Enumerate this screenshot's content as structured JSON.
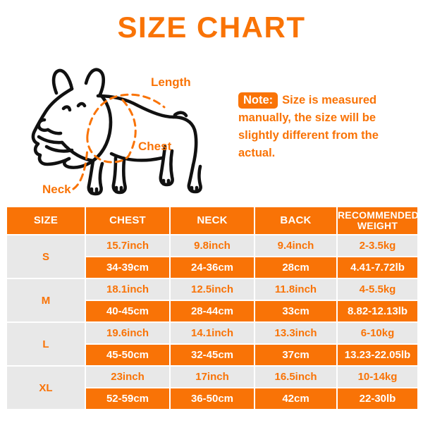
{
  "title": "SIZE CHART",
  "theme": {
    "accent": "#F97306",
    "light_row": "#E8E8E8",
    "size_cell": "#E4E4E4",
    "text_on_accent": "#FFFFFF",
    "outline": "#000000"
  },
  "note": {
    "badge": "Note:",
    "lines": [
      "Size is measured",
      "manually, the size will be",
      "slightly different from the",
      "actual."
    ]
  },
  "illustration": {
    "subject": "french-bulldog",
    "labels": {
      "length": "Length",
      "chest": "Chest",
      "neck": "Neck"
    }
  },
  "table": {
    "headers": [
      "SIZE",
      "CHEST",
      "NECK",
      "BACK",
      "RECOMMENDED WEIGHT"
    ],
    "header_weight_line1": "RECOMMENDED",
    "header_weight_line2": "WEIGHT",
    "rows": [
      {
        "size": "S",
        "inch": {
          "chest": "15.7inch",
          "neck": "9.8inch",
          "back": "9.4inch",
          "weight": "2-3.5kg"
        },
        "cm": {
          "chest": "34-39cm",
          "neck": "24-36cm",
          "back": "28cm",
          "weight": "4.41-7.72lb"
        }
      },
      {
        "size": "M",
        "inch": {
          "chest": "18.1inch",
          "neck": "12.5inch",
          "back": "11.8inch",
          "weight": "4-5.5kg"
        },
        "cm": {
          "chest": "40-45cm",
          "neck": "28-44cm",
          "back": "33cm",
          "weight": "8.82-12.13lb"
        }
      },
      {
        "size": "L",
        "inch": {
          "chest": "19.6inch",
          "neck": "14.1inch",
          "back": "13.3inch",
          "weight": "6-10kg"
        },
        "cm": {
          "chest": "45-50cm",
          "neck": "32-45cm",
          "back": "37cm",
          "weight": "13.23-22.05lb"
        }
      },
      {
        "size": "XL",
        "inch": {
          "chest": "23inch",
          "neck": "17inch",
          "back": "16.5inch",
          "weight": "10-14kg"
        },
        "cm": {
          "chest": "52-59cm",
          "neck": "36-50cm",
          "back": "42cm",
          "weight": "22-30lb"
        }
      }
    ]
  }
}
